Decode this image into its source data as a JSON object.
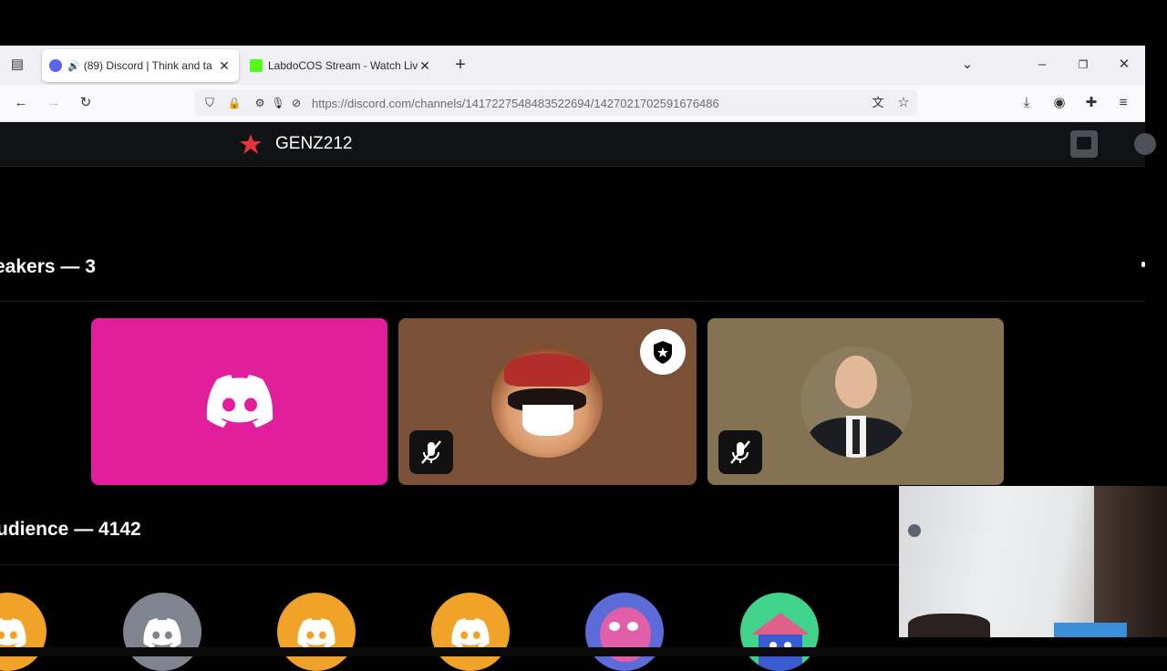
{
  "browser": {
    "tabs": [
      {
        "title": "(89) Discord | Think and ta",
        "favicon_color": "#5865f2",
        "badge": "89",
        "active": true
      },
      {
        "title": "LabdoCOS Stream - Watch Live",
        "favicon_color": "#53fc18",
        "active": false
      }
    ],
    "url": "https://discord.com/channels/1417227548483522694/1427021702591676486"
  },
  "discord": {
    "server_name": "GENZ212",
    "speakers_label": "eakers — 3",
    "audience_label": "udience — 4142",
    "colors": {
      "speaker_pink": "#e31e9c",
      "speaker_brown": "#7a5136",
      "speaker_olive": "#857253",
      "default_avatar_orange": "#f0a229",
      "default_avatar_gray": "#80848e"
    },
    "speakers": [
      {
        "avatar": "discord-logo",
        "muted": false,
        "moderator": false
      },
      {
        "avatar": "laughing-pirate",
        "muted": true,
        "moderator": true
      },
      {
        "avatar": "faceless-man-suit",
        "muted": true,
        "moderator": false
      }
    ],
    "audience": [
      {
        "avatar": "discord-logo-orange"
      },
      {
        "avatar": "discord-logo-gray"
      },
      {
        "avatar": "discord-logo-orange"
      },
      {
        "avatar": "discord-logo-orange"
      },
      {
        "avatar": "pink-character"
      },
      {
        "avatar": "house-character"
      }
    ]
  }
}
